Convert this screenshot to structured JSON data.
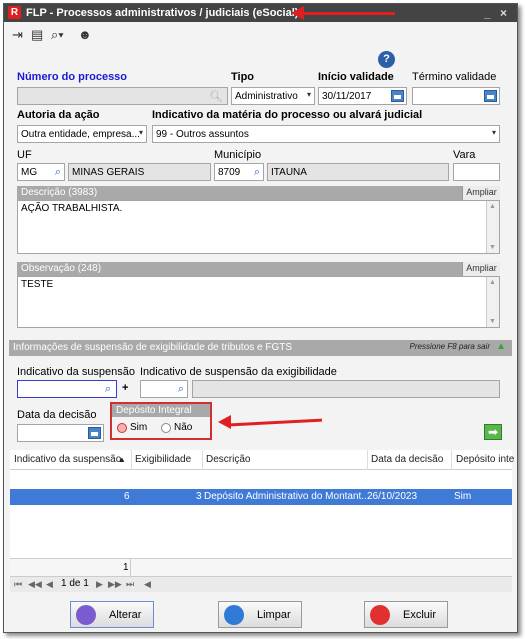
{
  "window": {
    "logo": "R",
    "title": "FLP - Processos administrativos / judiciais (eSocial)",
    "min": "_",
    "close": "×"
  },
  "toolbar": {
    "icons": [
      "exit-icon",
      "screen-icon",
      "search-icon",
      "user-icon"
    ]
  },
  "form": {
    "numero_processo_label": "Número do processo",
    "numero_processo_value": "",
    "tipo_label": "Tipo",
    "tipo_value": "Administrativo",
    "inicio_label": "Início validade",
    "inicio_value": "30/11/2017",
    "termino_label": "Término validade",
    "termino_value": "",
    "autoria_label": "Autoria da ação",
    "autoria_value": "Outra entidade, empresa...",
    "indicativo_label": "Indicativo da matéria do processo ou alvará judicial",
    "indicativo_value": "99 - Outros assuntos",
    "uf_label": "UF",
    "uf_value": "MG",
    "uf_name": "MINAS GERAIS",
    "municipio_label": "Município",
    "municipio_code": "8709",
    "municipio_name": "ITAUNA",
    "vara_label": "Vara",
    "vara_value": "",
    "descricao_label": "Descrição (3983)",
    "descricao_value": "AÇÃO TRABALHISTA.",
    "observacao_label": "Observação (248)",
    "observacao_value": "TESTE",
    "ampliar": "Ampliar"
  },
  "suspensao": {
    "header": "Informações de suspensão de exigibilidade de tributos e FGTS",
    "hint": "Pressione F8 para sair",
    "indicativo_label": "Indicativo da suspensão",
    "indicativo_exig_label": "Indicativo de suspensão da exigibilidade",
    "data_decisao_label": "Data da decisão",
    "deposito_label": "Depósito Integral",
    "sim": "Sim",
    "nao": "Não",
    "plus": "+"
  },
  "grid": {
    "columns": [
      "Indicativo da suspensão",
      "Exigibilidade",
      "Descrição",
      "Data da decisão",
      "Depósito inte"
    ],
    "sort_icon": "▲",
    "rows": [
      {
        "indicativo": "6",
        "exigibilidade": "3",
        "descricao": "Depósito Administrativo do Montant...",
        "data": "26/10/2023",
        "deposito": "Sim"
      }
    ],
    "footer_count": "1",
    "page": "1 de 1"
  },
  "buttons": {
    "alterar": "Alterar",
    "limpar": "Limpar",
    "excluir": "Excluir"
  },
  "colors": {
    "accent_red": "#e02020",
    "selection_blue": "#3f7ad6",
    "label_blue": "#1a1ad6"
  }
}
